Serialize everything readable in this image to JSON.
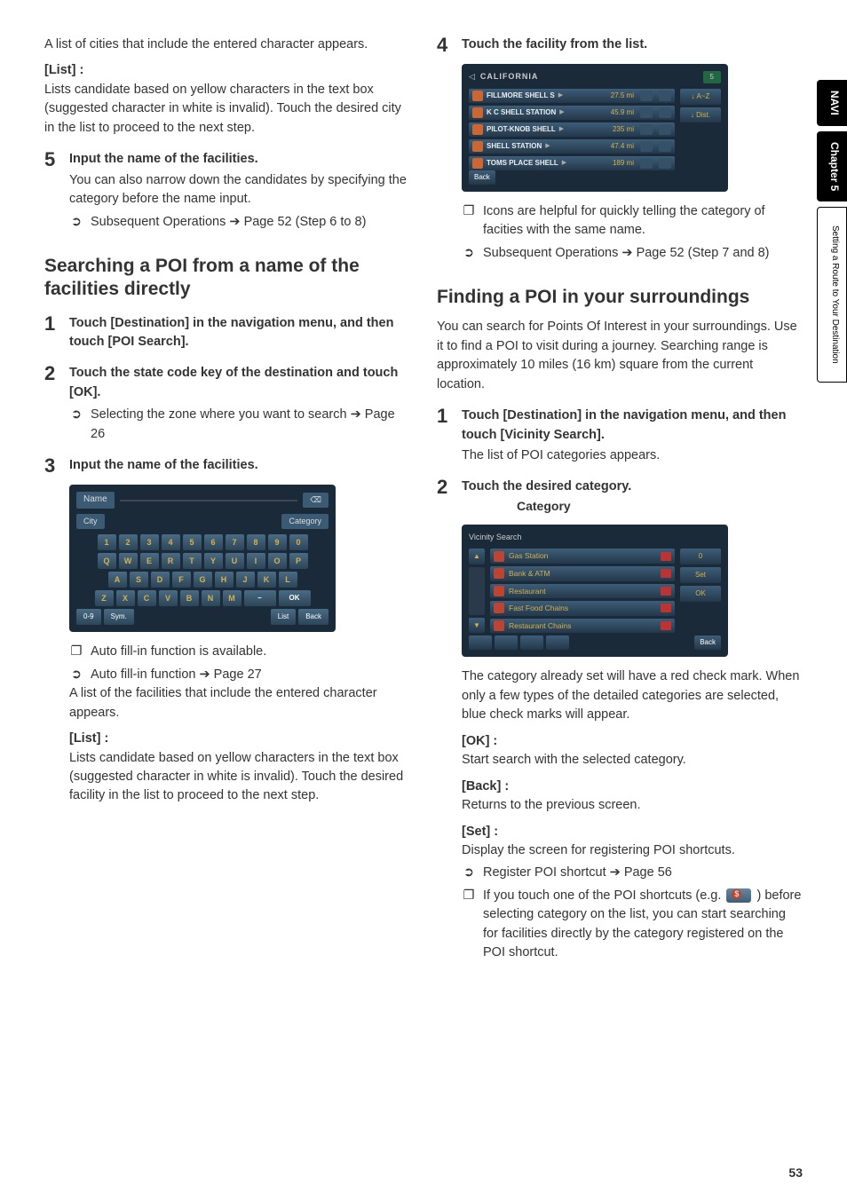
{
  "side": {
    "navi": "NAVI",
    "chapter": "Chapter 5",
    "chapter_title": "Setting a Route to Your Destination"
  },
  "page_number": "53",
  "left": {
    "intro1": "A list of cities that include the entered character appears.",
    "list_label": "[List] :",
    "list_desc": "Lists candidate based on yellow characters in the text box (suggested character in white is invalid). Touch the desired city in the list to proceed to the next step.",
    "s5": {
      "n": "5",
      "title": "Input the name of the facilities.",
      "p1": "You can also narrow down the candidates by specifying the category before the name input.",
      "sub": "Subsequent Operations ➔ Page 52 (Step 6 to 8)"
    },
    "h2": "Searching a POI from a name of the facilities directly",
    "s1": {
      "n": "1",
      "title": "Touch [Destination] in the navigation menu, and then touch [POI Search]."
    },
    "s2": {
      "n": "2",
      "title": "Touch the state code key of the destination and touch [OK].",
      "sub": "Selecting the zone where you want to search ➔ Page 26"
    },
    "s3": {
      "n": "3",
      "title": "Input the name of the facilities."
    },
    "kb": {
      "name": "Name",
      "bs": "⌫",
      "city": "City",
      "category": "Category",
      "rows": [
        [
          "1",
          "2",
          "3",
          "4",
          "5",
          "6",
          "7",
          "8",
          "9",
          "0"
        ],
        [
          "Q",
          "W",
          "E",
          "R",
          "T",
          "Y",
          "U",
          "I",
          "O",
          "P"
        ],
        [
          "A",
          "S",
          "D",
          "F",
          "G",
          "H",
          "J",
          "K",
          "L"
        ],
        [
          "Z",
          "X",
          "C",
          "V",
          "B",
          "N",
          "M",
          "–",
          "OK"
        ]
      ],
      "bottom": [
        "0-9",
        "Sym.",
        "",
        "List",
        "Back"
      ]
    },
    "after_fig_note": "Auto fill-in function is available.",
    "after_fig_ref": "Auto fill-in function ➔ Page 27",
    "after_fig_p1": "A list of the facilities that include the entered character appears.",
    "list2_label": "[List] :",
    "list2_desc": "Lists candidate based on yellow characters in the text box (suggested character in white is invalid). Touch the desired facility in the list to proceed to the next step."
  },
  "right": {
    "s4": {
      "n": "4",
      "title": "Touch the facility from the list."
    },
    "results": {
      "title": "CALIFORNIA",
      "count": "5",
      "items": [
        {
          "name": "FILLMORE SHELL S",
          "dist": "27.5 mi"
        },
        {
          "name": "K C SHELL STATION",
          "dist": "45.9 mi"
        },
        {
          "name": "PILOT-KNOB SHELL",
          "dist": "235 mi"
        },
        {
          "name": "SHELL STATION",
          "dist": "47.4 mi"
        },
        {
          "name": "TOMS PLACE SHELL",
          "dist": "189 mi"
        }
      ],
      "side": [
        "↓ A~Z",
        "↓ Dist."
      ],
      "back": "Back"
    },
    "s4_note": "Icons are helpful for quickly telling the category of facities with the same name.",
    "s4_ref": "Subsequent Operations ➔ Page 52 (Step 7 and 8)",
    "h2": "Finding a POI in your surroundings",
    "p1": "You can search for Points Of Interest in your surroundings. Use it to find a POI to visit during a journey. Searching range is approximately 10 miles (16 km) square from the current location.",
    "rs1": {
      "n": "1",
      "title": "Touch [Destination] in the navigation menu, and then touch [Vicinity Search].",
      "p": "The list of POI categories appears."
    },
    "rs2": {
      "n": "2",
      "title": "Touch the desired category.",
      "callout": "Category"
    },
    "cats": {
      "title": "Vicinity Search",
      "items": [
        "Gas Station",
        "Bank & ATM",
        "Restaurant",
        "Fast Food Chains",
        "Restaurant Chains"
      ],
      "side": [
        "0",
        "Set",
        "OK"
      ],
      "back": "Back"
    },
    "after_cat_p": "The category already set will have a red check mark. When only a few types of the detailed categories are selected, blue check marks will appear.",
    "ok_label": "[OK] :",
    "ok_desc": "Start search with the selected category.",
    "back_label": "[Back] :",
    "back_desc": "Returns to the previous screen.",
    "set_label": "[Set] :",
    "set_desc": "Display the screen for registering POI shortcuts.",
    "reg_ref": "Register POI shortcut ➔ Page 56",
    "tip_a": "If you touch one of the POI shortcuts (e.g.",
    "tip_b": ") before selecting category on the list, you can start searching for facilities directly by the category registered on the POI shortcut."
  }
}
